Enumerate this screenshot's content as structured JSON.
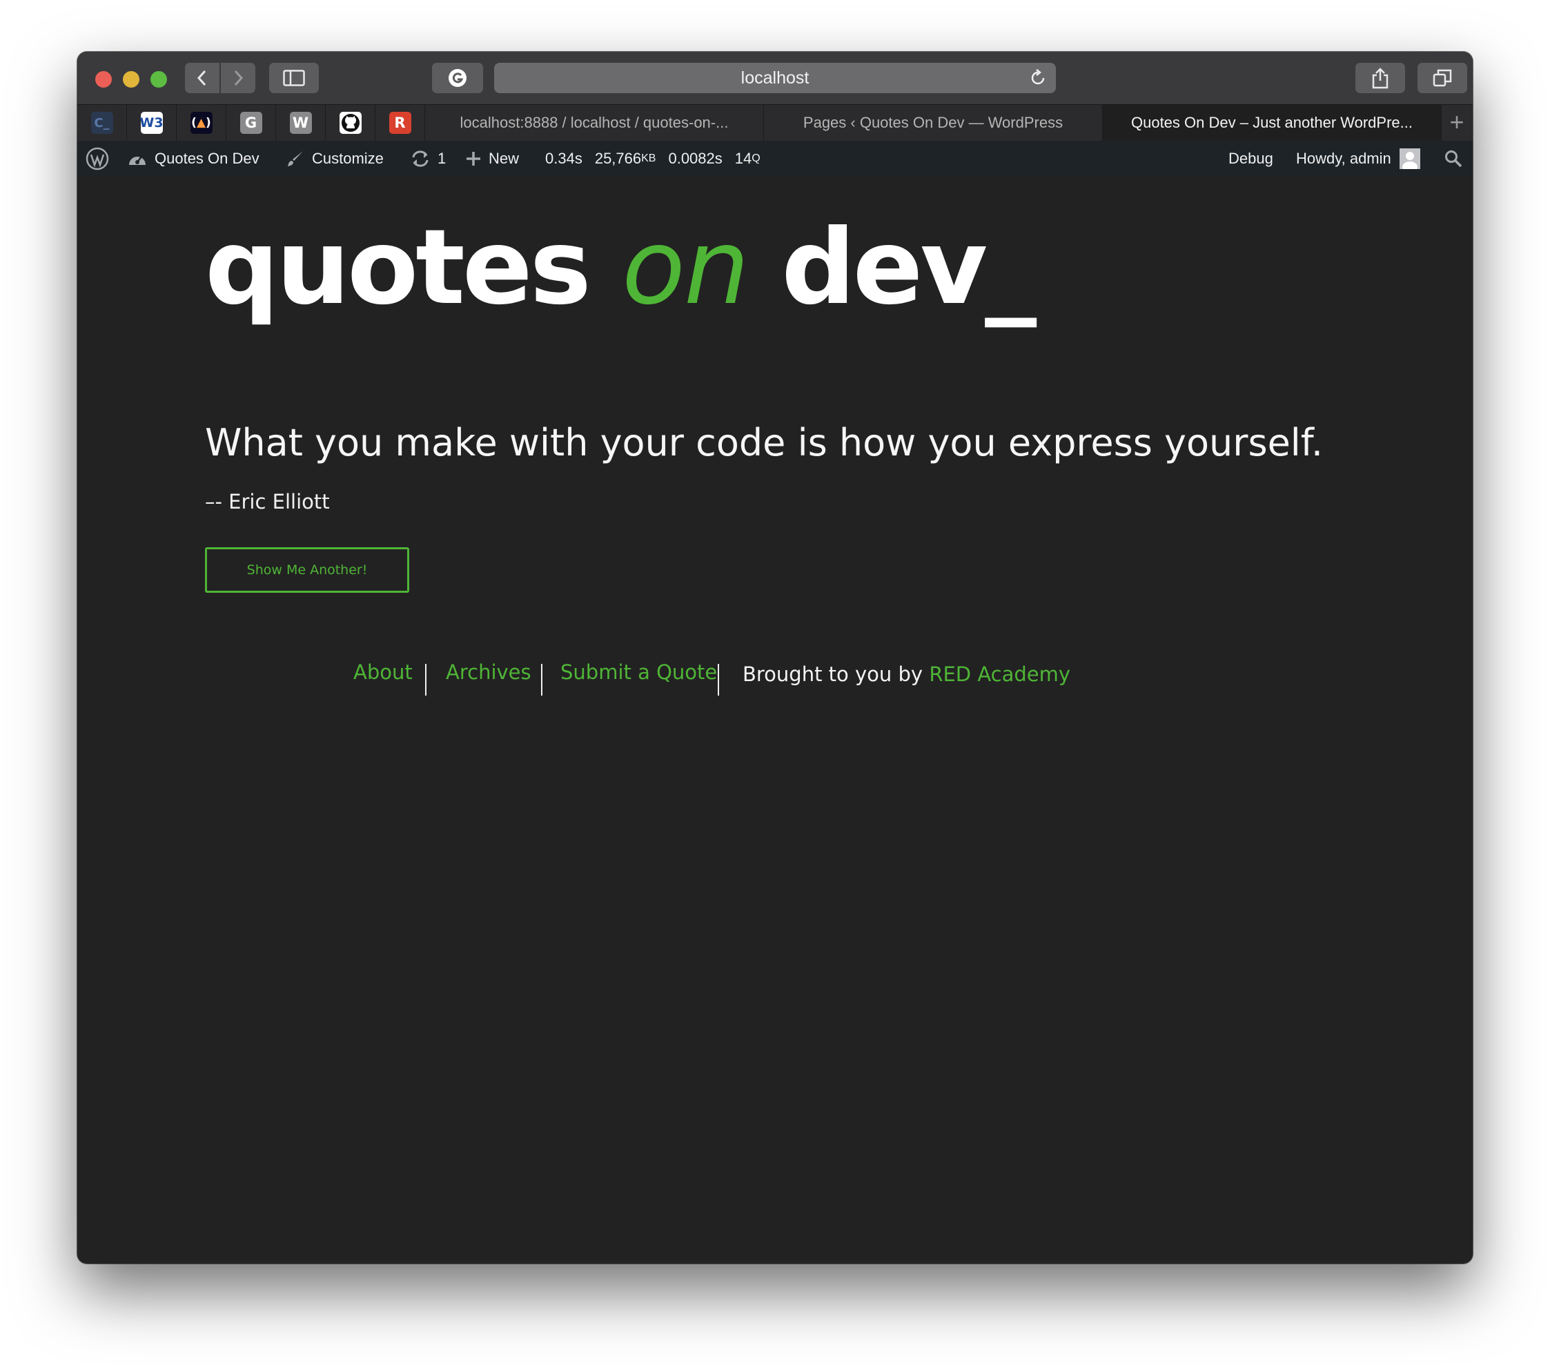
{
  "browser": {
    "address": "localhost",
    "pinned_tabs": [
      {
        "icon": "codepen-icon",
        "label": "C_"
      },
      {
        "icon": "w3schools-icon",
        "label": "W3"
      },
      {
        "icon": "freecodecamp-icon",
        "label": "(🔥)"
      },
      {
        "icon": "google-icon",
        "label": "G"
      },
      {
        "icon": "wordpress-w-icon",
        "label": "W"
      },
      {
        "icon": "github-icon",
        "label": ""
      },
      {
        "icon": "red-academy-icon",
        "label": "R"
      }
    ],
    "tabs": [
      {
        "label": "localhost:8888 / localhost / quotes-on-..."
      },
      {
        "label": "Pages ‹ Quotes On Dev — WordPress"
      },
      {
        "label": "Quotes On Dev – Just another WordPre..."
      }
    ]
  },
  "adminbar": {
    "site_name": "Quotes On Dev",
    "customize": "Customize",
    "updates_count": "1",
    "new_label": "New",
    "stat_time": "0.34s",
    "stat_mem": "25,766",
    "stat_mem_unit": "KB",
    "stat_query_time": "0.0082s",
    "stat_queries": "14",
    "stat_queries_unit": "Q",
    "debug": "Debug",
    "howdy": "Howdy, admin"
  },
  "site": {
    "title_part1": "quotes",
    "title_part2": "on",
    "title_part3": "dev_",
    "quote": "What you make with your code is how you express yourself.",
    "author": "–- Eric Elliott",
    "button": "Show Me Another!",
    "footer": {
      "about": "About",
      "archives": "Archives",
      "submit": "Submit a Quote",
      "brought_by": "Brought to you by",
      "red_academy": "RED Academy"
    },
    "accent_color": "#4fb536",
    "background_color": "#222222"
  }
}
